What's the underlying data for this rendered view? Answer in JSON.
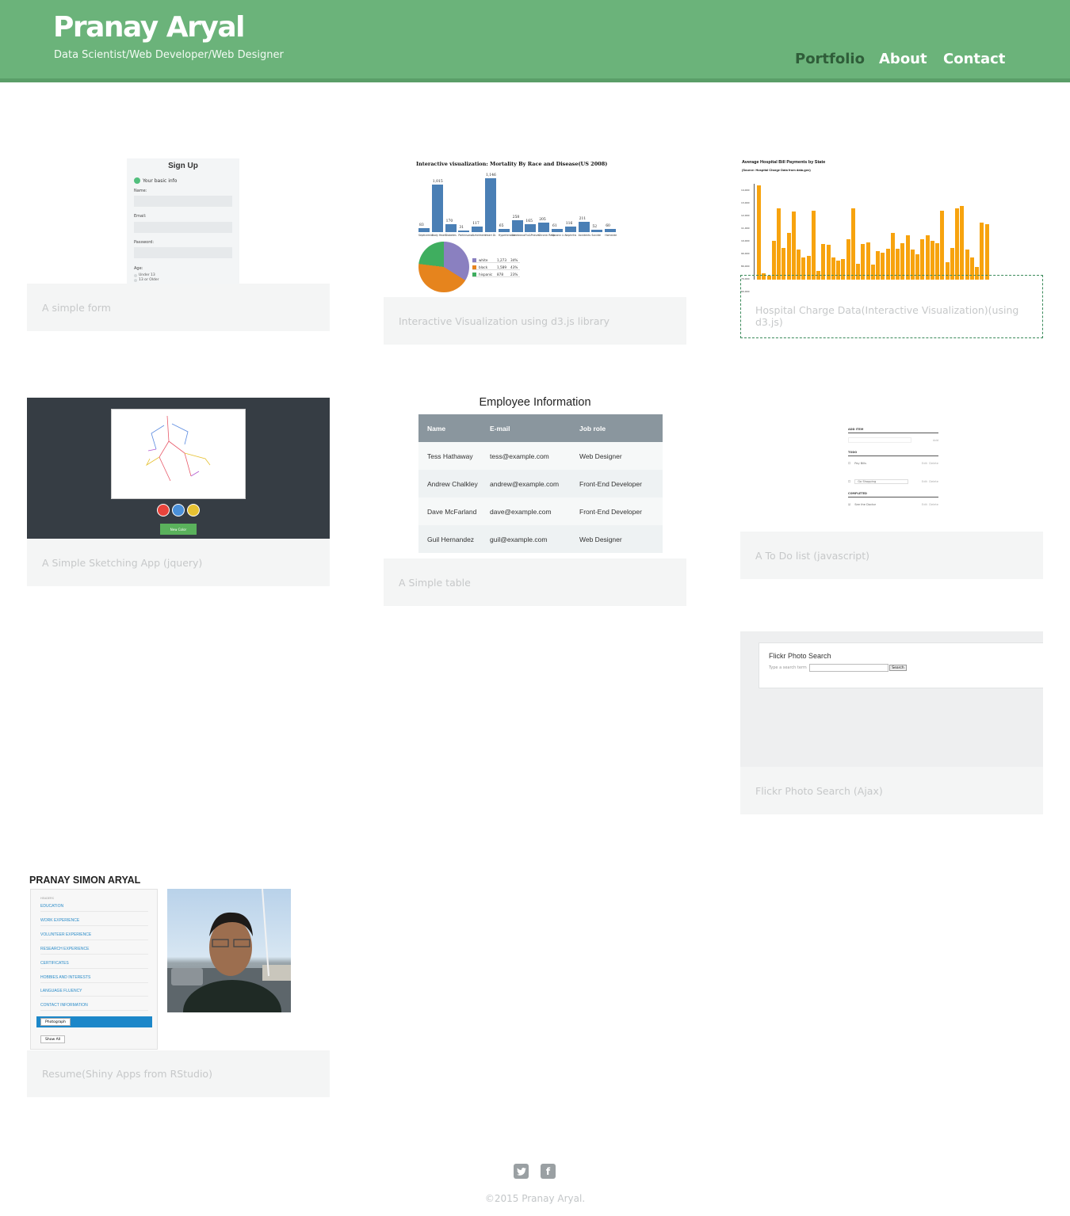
{
  "header": {
    "title": "Pranay Aryal",
    "subtitle": "Data Scientist/Web Developer/Web Designer",
    "nav": [
      {
        "label": "Portfolio",
        "active": true
      },
      {
        "label": "About",
        "active": false
      },
      {
        "label": "Contact",
        "active": false
      }
    ],
    "bg_color": "#6bb37a"
  },
  "portfolio": [
    {
      "caption": "A simple form"
    },
    {
      "caption": "Interactive Visualization using d3.js library"
    },
    {
      "caption": "Hospital Charge Data(Interactive Visualization)(using d3.js)"
    },
    {
      "caption": "A Simple Sketching App (jquery)"
    },
    {
      "caption": "A Simple table"
    },
    {
      "caption": "A To Do list (javascript)"
    },
    {
      "caption": "Flickr Photo Search (Ajax)"
    },
    {
      "caption": "Resume(Shiny Apps from RStudio)"
    }
  ],
  "signup": {
    "title": "Sign Up",
    "step": "Your basic info",
    "name_label": "Name:",
    "email_label": "Email:",
    "password_label": "Password:",
    "age_label": "Age:",
    "age_options": [
      "Under 13",
      "13 or Older"
    ]
  },
  "mortality": {
    "title": "Interactive visualization: Mortality By Race and Disease(US 2008)",
    "bars": [
      {
        "value": 83,
        "cat": "Septicemia"
      },
      {
        "value": 1015,
        "label": "1,015",
        "cat": "Body Heart"
      },
      {
        "value": 170,
        "cat": "Diabetes"
      },
      {
        "value": 31,
        "cat": "Parkinsons"
      },
      {
        "value": 117,
        "cat": "Alzheimers"
      },
      {
        "value": 1146,
        "label": "1,146",
        "cat": "Heart Di."
      },
      {
        "value": 65,
        "cat": "Hypertension"
      },
      {
        "value": 258,
        "cat": "Cerebrova."
      },
      {
        "value": 165,
        "cat": "Flu&Pneum."
      },
      {
        "value": 205,
        "cat": "Chronic Resp."
      },
      {
        "value": 61,
        "cat": "Chronic Li."
      },
      {
        "value": 116,
        "cat": "Nephritis"
      },
      {
        "value": 211,
        "cat": "Accidents"
      },
      {
        "value": 52,
        "cat": "Suicide"
      },
      {
        "value": 60,
        "cat": "Homicide"
      }
    ],
    "legend": [
      {
        "name": "white",
        "count": "1,273",
        "pct": "34%",
        "color": "#8a80c0"
      },
      {
        "name": "black",
        "count": "1,589",
        "pct": "43%",
        "color": "#e6841d"
      },
      {
        "name": "hispanic",
        "count": "878",
        "pct": "23%",
        "color": "#3fae5f"
      }
    ]
  },
  "hospital": {
    "title": "Average Hospital Bill Payments by State",
    "subtitle": "(Source: Hospital Charge Data from data.gov)",
    "ticks": [
      "14,000",
      "13,000",
      "12,000",
      "11,000",
      "10,000",
      "90,000",
      "80,000",
      "70,000",
      "60,000"
    ],
    "values": [
      118,
      8,
      5,
      49,
      89,
      40,
      59,
      85,
      38,
      28,
      30,
      86,
      11,
      45,
      44,
      28,
      24,
      26,
      51,
      89,
      20,
      45,
      47,
      19,
      36,
      34,
      39,
      59,
      39,
      46,
      56,
      38,
      32,
      51,
      56,
      49,
      46,
      86,
      22,
      40,
      89,
      92,
      38,
      28,
      16,
      71,
      69
    ]
  },
  "sketch": {
    "button": "New Color",
    "colors": [
      "#e8443c",
      "#4a90d9",
      "#e6c132"
    ]
  },
  "employees": {
    "title": "Employee Information",
    "headers": [
      "Name",
      "E-mail",
      "Job role"
    ],
    "rows": [
      [
        "Tess Hathaway",
        "tess@example.com",
        "Web Designer"
      ],
      [
        "Andrew Chalkley",
        "andrew@example.com",
        "Front-End Developer"
      ],
      [
        "Dave McFarland",
        "dave@example.com",
        "Front-End Developer"
      ],
      [
        "Guil Hernandez",
        "guil@example.com",
        "Web Designer"
      ]
    ]
  },
  "todo": {
    "add_heading": "ADD ITEM",
    "add_button": "Add",
    "todo_heading": "TODO",
    "items": [
      "Pay Bills",
      "Go Shopping"
    ],
    "completed_heading": "COMPLETED",
    "completed": [
      "See the Doctor"
    ],
    "edit": "Edit",
    "delete": "Delete"
  },
  "flickr": {
    "title": "Flickr Photo Search",
    "label": "Type a search term",
    "button": "Search"
  },
  "resume": {
    "name": "PRANAY SIMON ARYAL",
    "headers_label": "HEADERS",
    "links": [
      "EDUCATION",
      "WORK EXPERIENCE",
      "VOLUNTEER EXPERIENCE",
      "RESEARCH EXPERIENCE",
      "CERTIFICATES",
      "HOBBIES AND INTERESTS",
      "LANGUAGE FLUENCY",
      "CONTACT INFORMATION"
    ],
    "selected": "Photograph",
    "show_all": "Show All"
  },
  "footer": {
    "twitter_icon": "twitter-icon",
    "facebook_icon": "facebook-icon",
    "copyright": "©2015 Pranay Aryal."
  }
}
